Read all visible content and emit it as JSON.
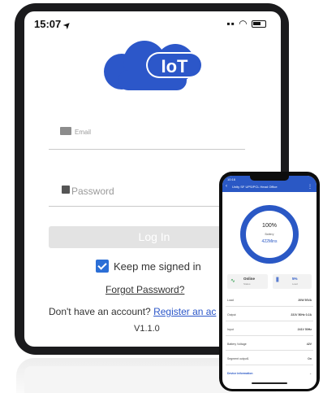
{
  "tablet": {
    "status_bar": {
      "time": "15:07",
      "location_glyph": "➤",
      "signal_icon": "signal-icon",
      "wifi_icon": "wifi-icon",
      "battery_icon": "battery-icon"
    },
    "logo": {
      "text": "IoT",
      "cloud_color": "#2c57c9"
    },
    "email": {
      "placeholder": "Email"
    },
    "password": {
      "placeholder": "Password"
    },
    "login_button": "Log In",
    "keep_signed_in": {
      "label": "Keep me signed in",
      "checked": true
    },
    "forgot_password": "Forgot Password?",
    "no_account_text": "Don't have an account?",
    "register_link": "Register an ac",
    "version": "V1.1.0"
  },
  "phone": {
    "header_time": "10:16",
    "header_title": "Unity SF UPS/PCL Head Office",
    "battery": {
      "percent": "100%",
      "label": "Battery",
      "runtime": "422Mins"
    },
    "status_card": {
      "title": "Online",
      "subtitle": "Status"
    },
    "load_card": {
      "value": "5%",
      "label": "Load"
    },
    "rows": [
      {
        "label": "Load",
        "values": "20W   50VA"
      },
      {
        "label": "Output",
        "values": "231V  50Hz  0.2A"
      },
      {
        "label": "Input",
        "values": "241V  50Hz"
      },
      {
        "label": "Battery Voltage",
        "values": "42V"
      },
      {
        "label": "Segment output1",
        "values": "On"
      }
    ],
    "device_information": "Device information"
  },
  "colors": {
    "accent": "#2c57c9",
    "checkbox": "#2c6fd6"
  }
}
